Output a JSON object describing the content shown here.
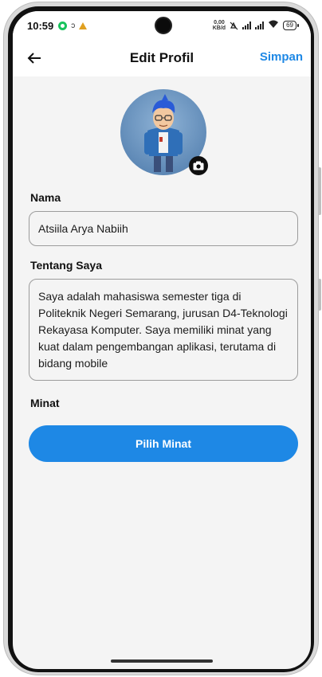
{
  "status_bar": {
    "time": "10:59",
    "speed_value": "0,00",
    "speed_unit": "KB/d",
    "battery": "69"
  },
  "app_bar": {
    "title": "Edit Profil",
    "save_label": "Simpan",
    "back_icon": "arrow-left-icon"
  },
  "profile": {
    "avatar_icon": "avatar-illustration",
    "camera_icon": "camera-icon"
  },
  "form": {
    "name_label": "Nama",
    "name_value": "Atsiila Arya Nabiih",
    "about_label": "Tentang Saya",
    "about_value": "Saya adalah mahasiswa semester tiga di Politeknik Negeri Semarang, jurusan D4-Teknologi Rekayasa Komputer. Saya memiliki minat yang kuat dalam pengembangan aplikasi, terutama di bidang mobile",
    "interest_label": "Minat",
    "interest_button": "Pilih Minat"
  },
  "colors": {
    "accent": "#1e88e5",
    "background": "#f4f4f4",
    "field_border": "#9c9c9c"
  }
}
